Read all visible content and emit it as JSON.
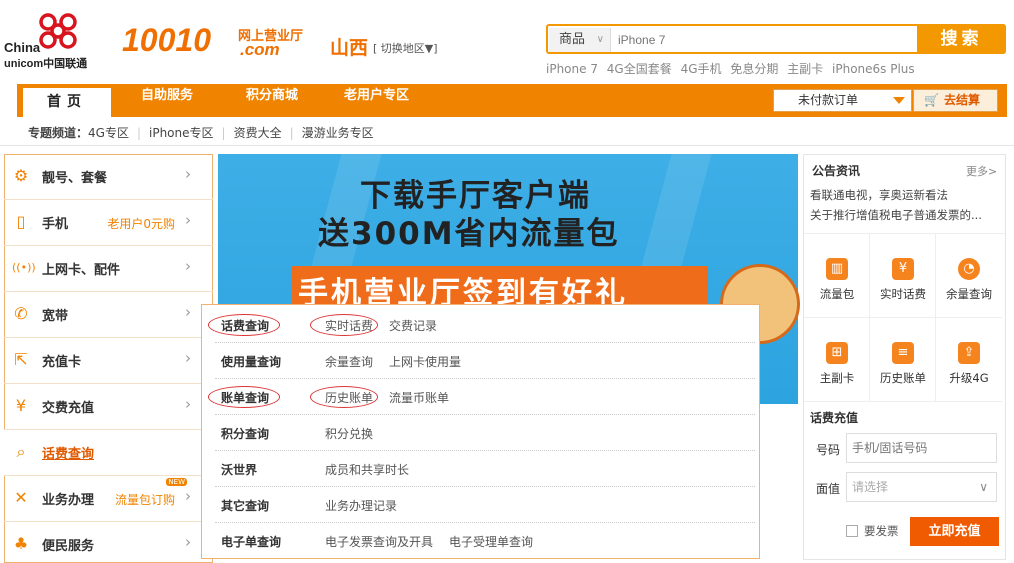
{
  "header": {
    "logo": {
      "cn": "China",
      "cn2": "unicom中国联通"
    },
    "brand": "10010",
    "brand_sub1": "网上营业厅",
    "brand_sub2": ".com",
    "region": "山西",
    "region_switch": "[ 切换地区▼]"
  },
  "search": {
    "category": "商品",
    "placeholder": "iPhone 7",
    "button": "搜索",
    "hot": [
      "iPhone 7",
      "4G全国套餐",
      "4G手机",
      "免息分期",
      "主副卡",
      "iPhone6s Plus"
    ]
  },
  "nav": {
    "items": [
      "首页",
      "自助服务",
      "积分商城",
      "老用户专区"
    ],
    "unpaid": "未付款订单",
    "checkout": "去结算"
  },
  "subnav": {
    "label": "专题频道：",
    "items": [
      "4G专区",
      "iPhone专区",
      "资费大全",
      "漫游业务专区"
    ]
  },
  "left_menu": [
    {
      "label": "靓号、套餐",
      "extra": "",
      "icon": "gear-icon"
    },
    {
      "label": "手机",
      "extra": "老用户0元购",
      "icon": "phone-icon"
    },
    {
      "label": "上网卡、配件",
      "extra": "",
      "icon": "signal-icon"
    },
    {
      "label": "宽带",
      "extra": "",
      "icon": "telephone-icon"
    },
    {
      "label": "充值卡",
      "extra": "",
      "icon": "external-link-icon"
    },
    {
      "label": "交费充值",
      "extra": "",
      "icon": "yen-icon"
    },
    {
      "label": "话费查询",
      "extra": "",
      "icon": "search-icon"
    },
    {
      "label": "业务办理",
      "extra": "流量包订购",
      "badge": "NEW",
      "icon": "tools-icon"
    },
    {
      "label": "便民服务",
      "extra": "",
      "icon": "people-icon"
    }
  ],
  "banner": {
    "line1": "下载手厅客户端",
    "line2": "送300M省内流量包",
    "line3": "手机营业厅签到有好礼"
  },
  "dropdown": [
    {
      "head": "话费查询",
      "subs": [
        "实时话费",
        "交费记录"
      ]
    },
    {
      "head": "使用量查询",
      "subs": [
        "余量查询",
        "上网卡使用量"
      ]
    },
    {
      "head": "账单查询",
      "subs": [
        "历史账单",
        "流量币账单"
      ]
    },
    {
      "head": "积分查询",
      "subs": [
        "积分兑换"
      ]
    },
    {
      "head": "沃世界",
      "subs": [
        "成员和共享时长"
      ]
    },
    {
      "head": "其它查询",
      "subs": [
        "业务办理记录"
      ]
    },
    {
      "head": "电子单查询",
      "subs": [
        "电子发票查询及开具",
        "电子受理单查询"
      ]
    }
  ],
  "notice": {
    "title": "公告资讯",
    "more": "更多>",
    "items": [
      "看联通电视，享奥运新看法",
      "关于推行增值税电子普通发票的..."
    ]
  },
  "quick_grid": [
    {
      "label": "流量包",
      "icon": "chart-icon"
    },
    {
      "label": "实时话费",
      "icon": "yen-card-icon"
    },
    {
      "label": "余量查询",
      "icon": "clock-icon"
    },
    {
      "label": "主副卡",
      "icon": "add-card-icon"
    },
    {
      "label": "历史账单",
      "icon": "list-icon"
    },
    {
      "label": "升级4G",
      "icon": "upgrade-icon"
    }
  ],
  "recharge": {
    "title": "话费充值",
    "num_label": "号码",
    "num_placeholder": "手机/固话号码",
    "face_label": "面值",
    "face_placeholder": "请选择",
    "invoice": "要发票",
    "button": "立即充值"
  },
  "colors": {
    "accent": "#f08300",
    "button": "#f05a00",
    "banner": "#2ca4e0"
  }
}
